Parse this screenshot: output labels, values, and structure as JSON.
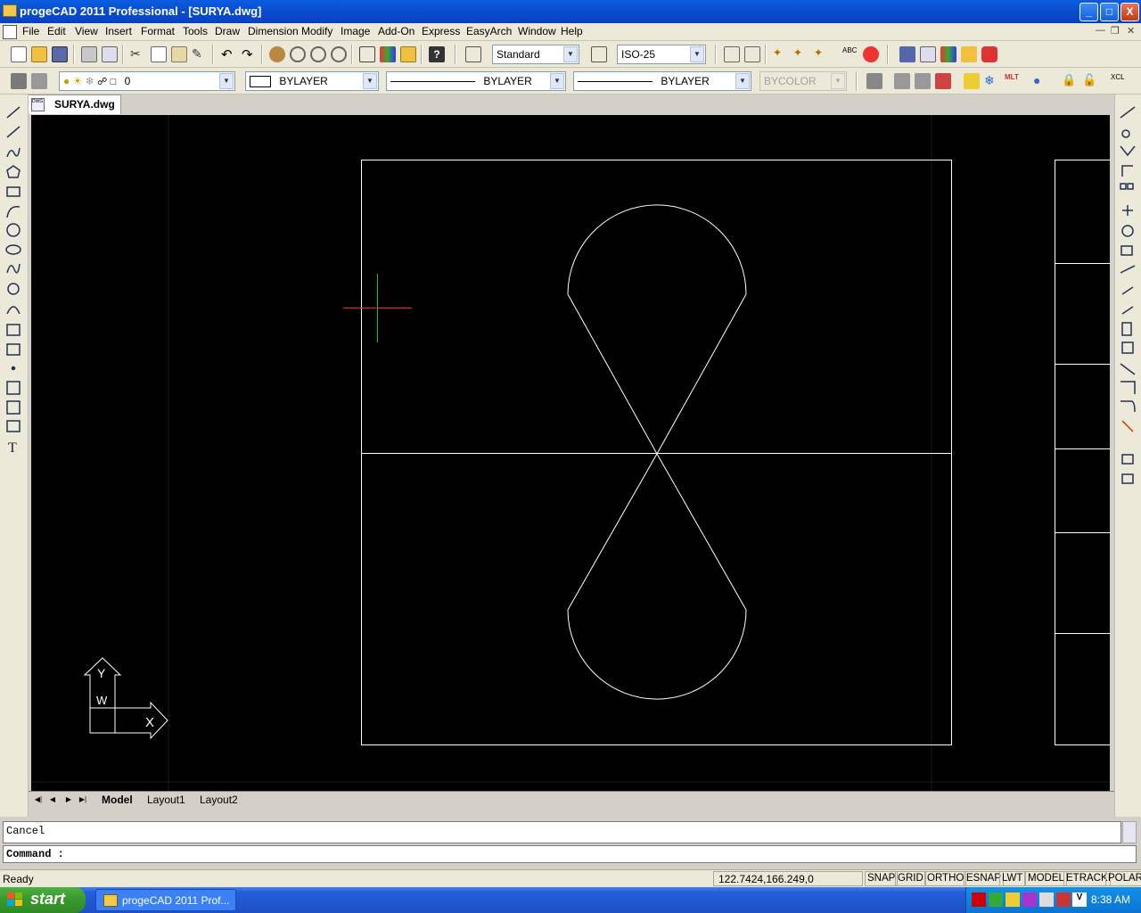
{
  "window": {
    "title": "progeCAD 2011 Professional - [SURYA.dwg]",
    "buttons": {
      "minimize": "_",
      "maximize": "□",
      "close": "X"
    }
  },
  "menu": {
    "items": [
      "File",
      "Edit",
      "View",
      "Insert",
      "Format",
      "Tools",
      "Draw",
      "Dimension",
      "Modify",
      "Image",
      "Add-On",
      "Express",
      "EasyArch",
      "Window",
      "Help"
    ]
  },
  "toolbar1": {
    "text_style": "Standard",
    "dim_style": "ISO-25"
  },
  "toolbar2": {
    "layer": "0",
    "color": "BYLAYER",
    "linetype": "BYLAYER",
    "lineweight": "BYLAYER",
    "plot_style": "BYCOLOR"
  },
  "document_tab": {
    "label": "SURYA.dwg",
    "icon_text": "DWG"
  },
  "ucs_icon": {
    "y_label": "Y",
    "w_label": "W",
    "x_label": "X"
  },
  "layout_tabs": [
    "Model",
    "Layout1",
    "Layout2"
  ],
  "command": {
    "history": "Cancel",
    "prompt": "Command :"
  },
  "status": {
    "ready": "Ready",
    "coords": "122.7424,166.249,0",
    "toggles": [
      "SNAP",
      "GRID",
      "ORTHO",
      "ESNAP",
      "LWT",
      "MODEL",
      "ETRACK",
      "POLAR"
    ]
  },
  "taskbar": {
    "start": "start",
    "item": "progeCAD 2011 Prof...",
    "clock": "8:38 AM"
  },
  "colors": {
    "canvas": "#000000",
    "geometry": "#ffffff",
    "crosshair_x": "#ff0000",
    "crosshair_y": "#00c000",
    "titlebar": "#0b4fd0"
  }
}
